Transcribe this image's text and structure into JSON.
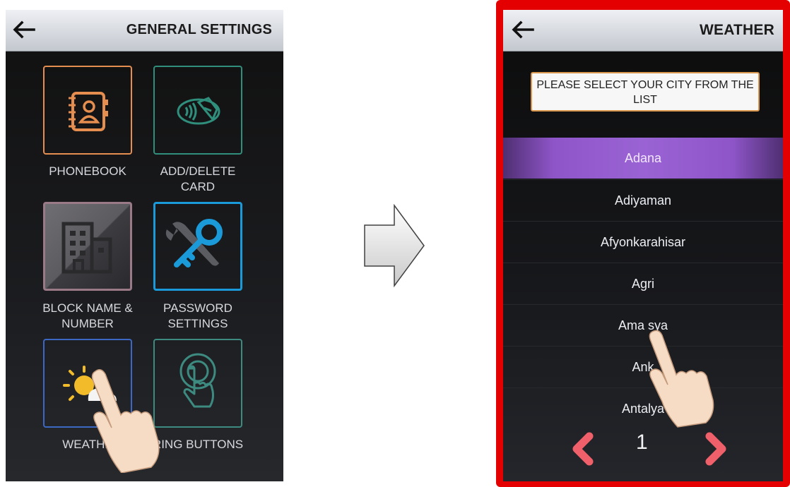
{
  "left_screen": {
    "title": "GENERAL SETTINGS",
    "tiles": [
      {
        "label": "PHONEBOOK",
        "icon": "phonebook-icon",
        "color": "#e58e50"
      },
      {
        "label": "ADD/DELETE\nCARD",
        "icon": "contactless-card-icon",
        "color": "#2f8f7c"
      },
      {
        "label": "BLOCK NAME &\nNUMBER",
        "icon": "building-icon",
        "color": "#9a7a86"
      },
      {
        "label": "PASSWORD\nSETTINGS",
        "icon": "key-wrench-icon",
        "color": "#1a9ad8"
      },
      {
        "label": "WEATHE",
        "icon": "weather-icon",
        "color": "#3c68c4"
      },
      {
        "label": "RING BUTTONS",
        "icon": "touch-button-icon",
        "color": "#3d8a80"
      }
    ]
  },
  "right_screen": {
    "title": "WEATHER",
    "prompt": "PLEASE SELECT YOUR CITY FROM THE LIST",
    "cities": [
      {
        "name": "Adana",
        "selected": true
      },
      {
        "name": "Adiyaman"
      },
      {
        "name": "Afyonkarahisar"
      },
      {
        "name": "Agri"
      },
      {
        "name": "Ama sya"
      },
      {
        "name": "Ank"
      },
      {
        "name": "Antalya"
      }
    ],
    "page": "1"
  },
  "colors": {
    "highlight_frame": "#e40000",
    "selected_row": "#9a63d4",
    "pager_arrows": "#f0606a"
  }
}
